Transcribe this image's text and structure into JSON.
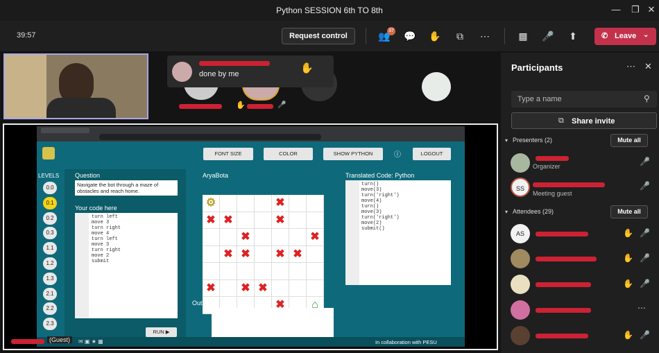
{
  "window": {
    "title": "Python SESSION 6th TO 8th"
  },
  "toolbar": {
    "timer": "39:57",
    "request_control": "Request control",
    "participants_badge": "37",
    "leave_label": "Leave"
  },
  "chat_popup": {
    "message": "done by me"
  },
  "shared_app": {
    "buttons": {
      "font_size": "FONT SIZE",
      "color": "COLOR",
      "show_python": "SHOW PYTHON",
      "logout": "LOGOUT"
    },
    "levels_label": "LEVELS",
    "levels": [
      "0.0",
      "0.1",
      "0.2",
      "0.3",
      "1.1",
      "1.2",
      "1.3",
      "2.1",
      "2.2",
      "2.3"
    ],
    "selected_level": "0.1",
    "question_title": "Question",
    "question_text": "Navigate the bot through a maze of obstacles and reach home.",
    "code_title": "Your code here",
    "code_lines": [
      "turn left",
      "move 3",
      "turn right",
      "move 4",
      "turn left",
      "move 3",
      "turn right",
      "move 2",
      "submit"
    ],
    "run_label": "RUN ▶",
    "grid_title": "AryaBota",
    "output_title": "Output",
    "translated_title": "Translated Code: Python",
    "translated_lines": [
      "turn()",
      "move(3)",
      "turn('right')",
      "move(4)",
      "turn()",
      "move(3)",
      "turn('right')",
      "move(2)",
      "submit()"
    ],
    "footer": "In collaboration with PESU",
    "guest_label": "(Guest)"
  },
  "participants": {
    "title": "Participants",
    "search_placeholder": "Type a name",
    "share_invite": "Share invite",
    "presenters_label": "Presenters (2)",
    "attendees_label": "Attendees (29)",
    "mute_all": "Mute all",
    "presenters": [
      {
        "role": "Organizer",
        "initials": ""
      },
      {
        "role": "Meeting guest",
        "initials": "SS"
      }
    ],
    "attendees": [
      {
        "initials": "AS"
      },
      {
        "initials": ""
      },
      {
        "initials": ""
      },
      {
        "initials": ""
      },
      {
        "initials": ""
      }
    ]
  },
  "colors": {
    "leave": "#c4314b",
    "accent": "#a7a7e6",
    "app_bg": "#0e6a7b",
    "grid_x": "#dd2222"
  }
}
